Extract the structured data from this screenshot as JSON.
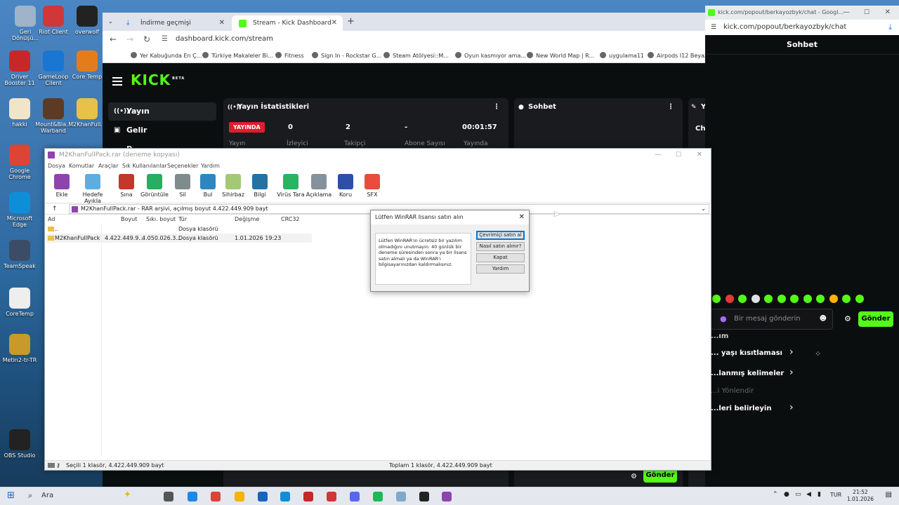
{
  "desktop": {
    "icons": [
      {
        "label": "Geri Dönüşü...",
        "color": "#9fb3c9"
      },
      {
        "label": "Riot Client",
        "color": "#d13639"
      },
      {
        "label": "overwolf",
        "color": "#222"
      },
      {
        "label": "Driver Booster 11",
        "color": "#c62828"
      },
      {
        "label": "GameLoop Client",
        "color": "#1976d2"
      },
      {
        "label": "Core Temp",
        "color": "#e57c1c"
      },
      {
        "label": "hakki",
        "color": "#f0e5c8"
      },
      {
        "label": "Mount&Bla... Warband",
        "color": "#5d3a24"
      },
      {
        "label": "M2KhanFull...",
        "color": "#e8c04a"
      },
      {
        "label": "Google Chrome",
        "color": "#db4437"
      },
      {
        "label": "Microsoft Edge",
        "color": "#0f8ed8"
      },
      {
        "label": "TeamSpeak",
        "color": "#3b4d66"
      },
      {
        "label": "CoreTemp",
        "color": "#eeeeee"
      },
      {
        "label": "Metin2-tr-TR",
        "color": "#c89a2a"
      },
      {
        "label": "OBS Studio",
        "color": "#222"
      }
    ]
  },
  "browser": {
    "tabs": [
      {
        "label": "İndirme geçmişi",
        "active": false
      },
      {
        "label": "Stream - Kick Dashboard",
        "active": true
      }
    ],
    "url": "dashboard.kick.com/stream",
    "bookmarks": [
      "Yer Kabuğunda En Ç...",
      "Türkiye Makaleler Bi...",
      "Fitness",
      "Sign In - Rockstar G...",
      "Steam Atölyesi::M...",
      "Oyun kasmıyor ama...",
      "New World Map | R...",
      "uygulama11",
      "Airpods I12 Beyaz I..."
    ]
  },
  "kick": {
    "logo": "KICK",
    "logo_sup": "BETA",
    "sidebar": [
      {
        "label": "Yayın"
      },
      {
        "label": "Gelir"
      },
      {
        "label": "P..."
      }
    ],
    "stats_panel": {
      "title": "Yayın İstatistikleri",
      "live": "YAYINDA",
      "stats": [
        {
          "value": "0",
          "label": "İzleyici"
        },
        {
          "value": "2",
          "label": "Takipçi"
        },
        {
          "value": "-",
          "label": "Abone Sayısı"
        },
        {
          "value": "00:01:57",
          "label": "Yayında"
        }
      ],
      "live_label": "Yayın"
    },
    "chat_panel": {
      "title": "Sohbet"
    },
    "third_panel": {
      "title": "Y...",
      "text": "Chi"
    },
    "send": "Gönder"
  },
  "popout": {
    "title": "kick.com/popout/berkayozbyk/chat - Googl...",
    "url": "kick.com/popout/berkayozbyk/chat",
    "header": "Sohbet",
    "message_placeholder": "Bir mesaj gönderin",
    "send": "Gönder",
    "menu": [
      {
        "label": "...ım"
      },
      {
        "label": "... yaşı kısıtlaması"
      },
      {
        "label": "...lanmış kelimeler"
      },
      {
        "label": "...i Yönlendir"
      },
      {
        "label": "...leri belirleyin"
      }
    ]
  },
  "winrar": {
    "title": "M2KhanFullPack.rar (deneme kopyası)",
    "menu": [
      "Dosya",
      "Komutlar",
      "Araçlar",
      "Sık Kullanılanlar",
      "Seçenekler",
      "Yardım"
    ],
    "toolbar": [
      {
        "label": "Ekle",
        "color": "#8e44ad"
      },
      {
        "label": "Hedefe Ayıkla",
        "color": "#5dade2"
      },
      {
        "label": "Sına",
        "color": "#c0392b"
      },
      {
        "label": "Görüntüle",
        "color": "#27ae60"
      },
      {
        "label": "Sil",
        "color": "#7f8c8d"
      },
      {
        "label": "Bul",
        "color": "#2e86c1"
      },
      {
        "label": "Sihirbaz",
        "color": "#a3c977"
      },
      {
        "label": "Bilgi",
        "color": "#2471a3"
      },
      {
        "label": "Virüs Tara",
        "color": "#28b463"
      },
      {
        "label": "Açıklama",
        "color": "#85929e"
      },
      {
        "label": "Koru",
        "color": "#2e4fa8"
      },
      {
        "label": "SFX",
        "color": "#e74c3c"
      }
    ],
    "path": "M2KhanFullPack.rar - RAR arşivi, açılmış boyut 4.422.449.909 bayt",
    "columns": [
      "Ad",
      "Boyut",
      "Sıkı. boyut",
      "Tür",
      "Değişme",
      "CRC32"
    ],
    "rows": [
      {
        "name": "..",
        "size": "",
        "packed": "",
        "type": "Dosya klasörü",
        "modified": ""
      },
      {
        "name": "M2KhanFullPack",
        "size": "4.422.449.9...",
        "packed": "4.050.026.3...",
        "type": "Dosya klasörü",
        "modified": "1.01.2026 19:23"
      }
    ],
    "status_left": "Seçili 1 klasör, 4.422.449.909 bayt",
    "status_right": "Toplam 1 klasör, 4.422.449.909 bayt"
  },
  "dialog": {
    "title": "Lütfen WinRAR lisansı satın alın",
    "message": "Lütfen WinRAR'ın ücretsiz bir yazılım olmadığını unutmayın. 40 günlük bir deneme süresinden sonra ya bir lisans satın almalı ya da WinRAR'ı bilgisayarınızdan kaldırmalısınız.",
    "buttons": [
      "Çevrimiçi satın al",
      "Nasıl satın alınır?",
      "Kapat",
      "Yardım"
    ]
  },
  "taskbar": {
    "search": "Ara",
    "lang": "TUR",
    "time": "21:52",
    "date": "1.01.2026"
  }
}
